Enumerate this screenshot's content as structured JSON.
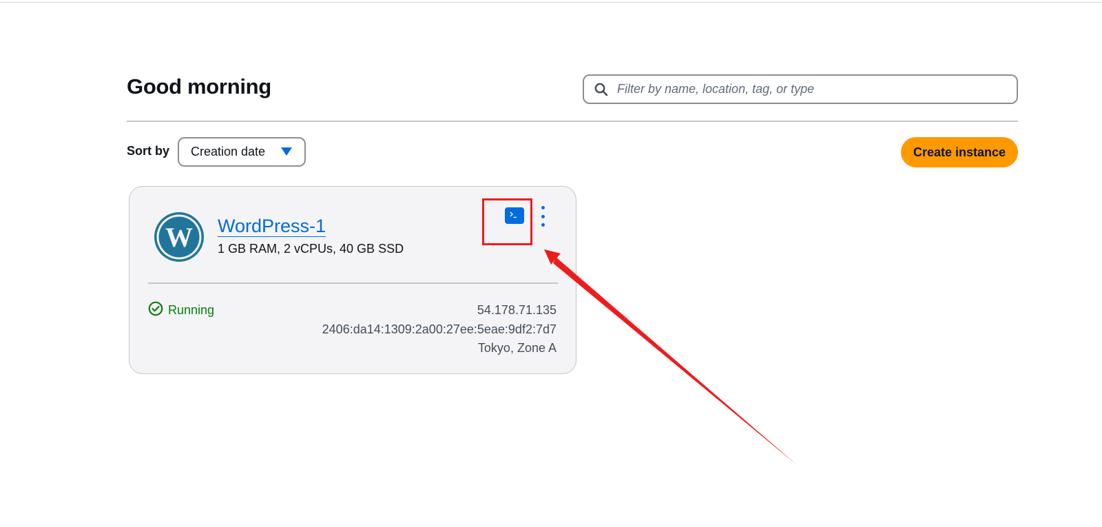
{
  "header": {
    "greeting": "Good morning",
    "search_placeholder": "Filter by name, location, tag, or type"
  },
  "toolbar": {
    "sort_label": "Sort by",
    "sort_value": "Creation date",
    "create_button_label": "Create instance"
  },
  "instances": [
    {
      "name": "WordPress-1",
      "spec": "1 GB RAM, 2 vCPUs, 40 GB SSD",
      "status": "Running",
      "ipv4": "54.178.71.135",
      "ipv6": "2406:da14:1309:2a00:27ee:5eae:9df2:7d7",
      "location": "Tokyo, Zone A",
      "blueprint_icon": "wordpress-logo-icon",
      "actions": [
        "connect-terminal-icon",
        "more-options-icon"
      ]
    }
  ],
  "colors": {
    "accent_blue": "#006ce0",
    "primary_button": "#ff9900",
    "status_running": "#037f0c",
    "annotation_red": "#ee1c1c"
  },
  "annotations": {
    "highlight": "connect-terminal-button",
    "arrow": "points-to-connect-terminal-button"
  }
}
